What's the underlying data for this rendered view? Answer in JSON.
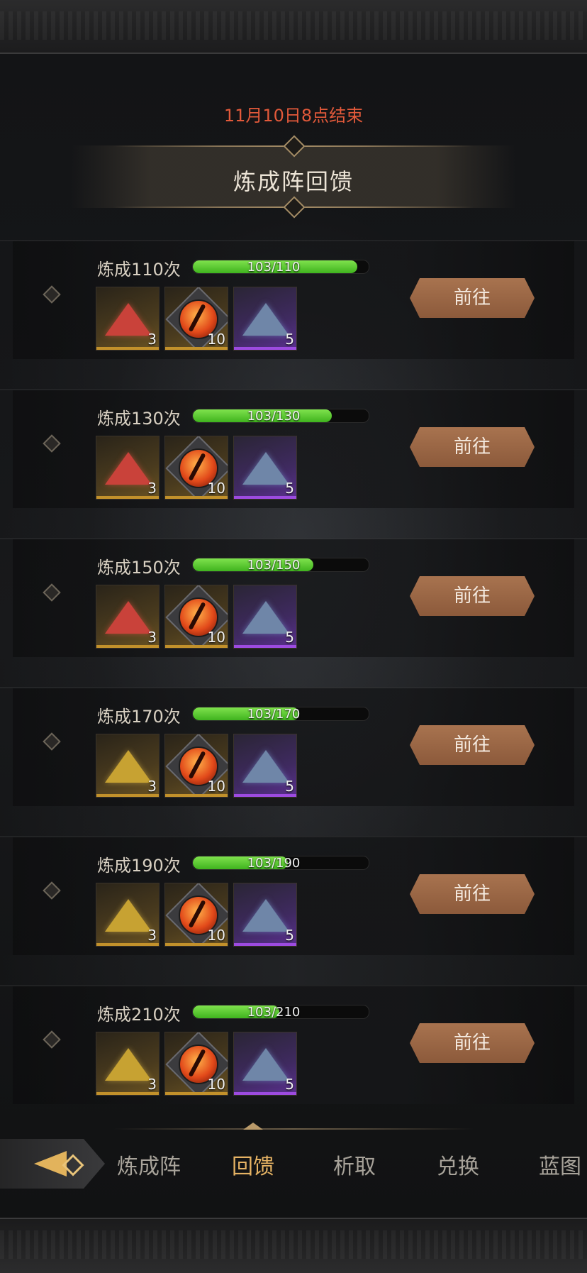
{
  "event": {
    "end_time": "11月10日8点结束",
    "title": "炼成阵回馈"
  },
  "rows": [
    {
      "label": "炼成110次",
      "progress_text": "103/110",
      "progress": 0.936,
      "button": "前往",
      "rewards": [
        {
          "icon": "red-powder-icon",
          "rarity": "gold",
          "count": "3"
        },
        {
          "icon": "fire-eye-orb-icon",
          "rarity": "gold",
          "count": "10"
        },
        {
          "icon": "blue-crystal-powder-icon",
          "rarity": "purple",
          "count": "5"
        }
      ]
    },
    {
      "label": "炼成130次",
      "progress_text": "103/130",
      "progress": 0.792,
      "button": "前往",
      "rewards": [
        {
          "icon": "red-powder-icon",
          "rarity": "gold",
          "count": "3"
        },
        {
          "icon": "fire-eye-orb-icon",
          "rarity": "gold",
          "count": "10"
        },
        {
          "icon": "blue-crystal-powder-icon",
          "rarity": "purple",
          "count": "5"
        }
      ]
    },
    {
      "label": "炼成150次",
      "progress_text": "103/150",
      "progress": 0.687,
      "button": "前往",
      "rewards": [
        {
          "icon": "red-powder-icon",
          "rarity": "gold",
          "count": "3"
        },
        {
          "icon": "fire-eye-orb-icon",
          "rarity": "gold",
          "count": "10"
        },
        {
          "icon": "blue-crystal-powder-icon",
          "rarity": "purple",
          "count": "5"
        }
      ]
    },
    {
      "label": "炼成170次",
      "progress_text": "103/170",
      "progress": 0.606,
      "button": "前往",
      "rewards": [
        {
          "icon": "gold-powder-icon",
          "rarity": "gold",
          "count": "3"
        },
        {
          "icon": "fire-eye-orb-icon",
          "rarity": "gold",
          "count": "10"
        },
        {
          "icon": "blue-crystal-powder-icon",
          "rarity": "purple",
          "count": "5"
        }
      ]
    },
    {
      "label": "炼成190次",
      "progress_text": "103/190",
      "progress": 0.542,
      "button": "前往",
      "rewards": [
        {
          "icon": "gold-powder-icon",
          "rarity": "gold",
          "count": "3"
        },
        {
          "icon": "fire-eye-orb-icon",
          "rarity": "gold",
          "count": "10"
        },
        {
          "icon": "blue-crystal-powder-icon",
          "rarity": "purple",
          "count": "5"
        }
      ]
    },
    {
      "label": "炼成210次",
      "progress_text": "103/210",
      "progress": 0.49,
      "button": "前往",
      "rewards": [
        {
          "icon": "gold-powder-icon",
          "rarity": "gold",
          "count": "3"
        },
        {
          "icon": "fire-eye-orb-icon",
          "rarity": "gold",
          "count": "10"
        },
        {
          "icon": "blue-crystal-powder-icon",
          "rarity": "purple",
          "count": "5"
        }
      ]
    }
  ],
  "nav": {
    "back_icon": "arrow-diamond-back-icon",
    "tabs": [
      {
        "label": "炼成阵",
        "active": false
      },
      {
        "label": "回馈",
        "active": true
      },
      {
        "label": "析取",
        "active": false
      },
      {
        "label": "兑换",
        "active": false
      },
      {
        "label": "蓝图",
        "active": false
      }
    ]
  },
  "colors": {
    "end_time": "#e2593a",
    "progress_fill": "#5fd33a",
    "active_tab": "#e6b364",
    "button": "#9c6a48"
  }
}
